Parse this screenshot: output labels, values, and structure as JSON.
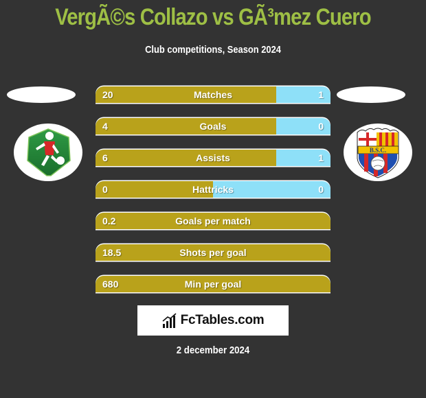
{
  "header": {
    "title": "VergÃ©s Collazo vs GÃ³mez Cuero",
    "subtitle": "Club competitions, Season 2024"
  },
  "colors": {
    "background": "#333333",
    "title": "#9ebf45",
    "left_bar": "#b9a21b",
    "right_bar": "#8ee0f8"
  },
  "teams": {
    "left": {
      "logo_icon": "football-player-shield-icon"
    },
    "right": {
      "logo_icon": "barcelona-sc-crest-icon",
      "crest_text": "B.S.C."
    }
  },
  "stats": [
    {
      "label": "Matches",
      "left": "20",
      "right": "1",
      "left_share": 0.77
    },
    {
      "label": "Goals",
      "left": "4",
      "right": "0",
      "left_share": 0.77
    },
    {
      "label": "Assists",
      "left": "6",
      "right": "1",
      "left_share": 0.77
    },
    {
      "label": "Hattricks",
      "left": "0",
      "right": "0",
      "left_share": 0.5
    },
    {
      "label": "Goals per match",
      "left": "0.2",
      "right": "",
      "left_share": 1
    },
    {
      "label": "Shots per goal",
      "left": "18.5",
      "right": "",
      "left_share": 1
    },
    {
      "label": "Min per goal",
      "left": "680",
      "right": "",
      "left_share": 1
    }
  ],
  "brand": {
    "name": "FcTables.com",
    "icon": "bar-chart-icon"
  },
  "footer": {
    "date": "2 december 2024"
  }
}
